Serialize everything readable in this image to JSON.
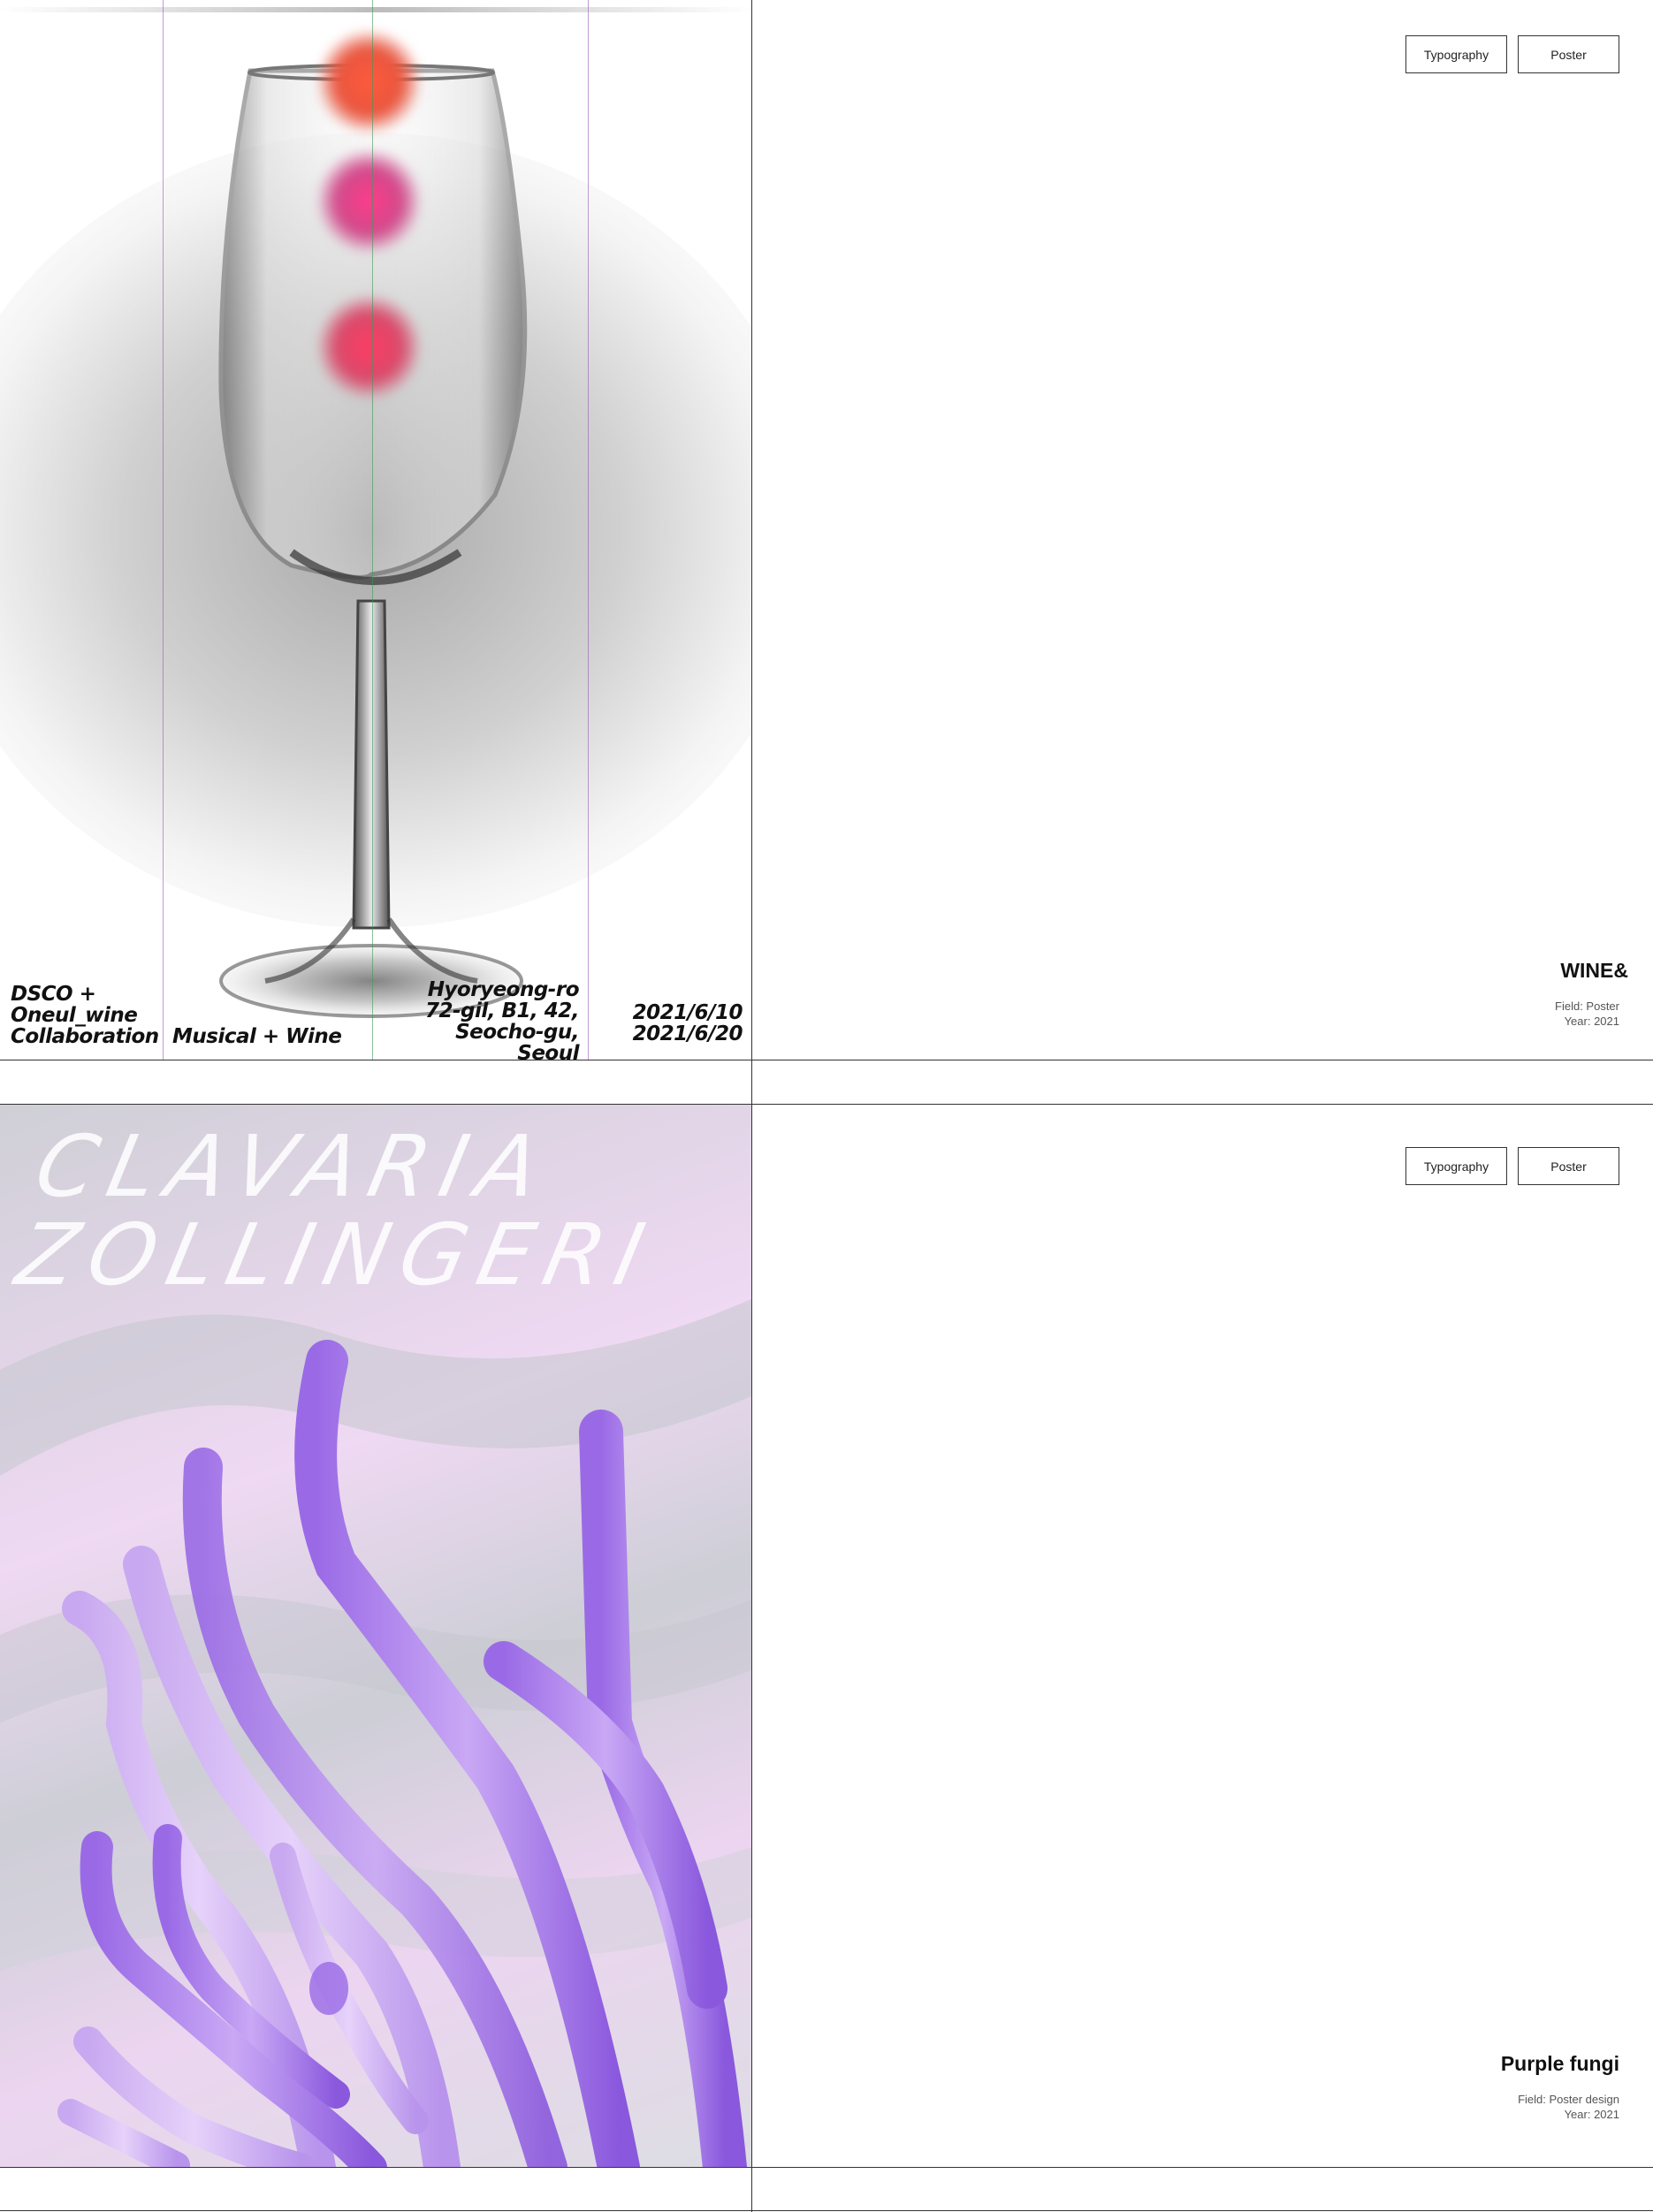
{
  "projects": [
    {
      "tags": [
        "Typography",
        "Poster"
      ],
      "title": "WINE&",
      "field": "Field: Poster",
      "year": "Year: 2021",
      "poster": {
        "left_text": [
          "DSCO +",
          "Oneul_wine",
          "Collaboration"
        ],
        "middle_text": "Musical + Wine",
        "address": [
          "Hyoryeong-ro",
          "72-gil,  B1, 42,",
          "Seocho-gu, Seoul"
        ],
        "dates": [
          "2021/6/10",
          "2021/6/20"
        ],
        "colors": {
          "orb_top": "#ff5a3c",
          "orb_mid": "#ff3c8a",
          "orb_low": "#ff3c64",
          "guide_purple": "#9b59b6",
          "guide_green": "#3c9a5c"
        }
      }
    },
    {
      "tags": [
        "Typography",
        "Poster"
      ],
      "title": "Purple fungi",
      "field": "Field: Poster design",
      "year": "Year: 2021",
      "poster": {
        "title_lines": [
          "CLAVARIA",
          "ZOLLINGERI"
        ],
        "colors": {
          "fungi": "#b48cf0",
          "background_pink": "#efd9f3",
          "background_gray": "#cdced6"
        }
      }
    }
  ]
}
